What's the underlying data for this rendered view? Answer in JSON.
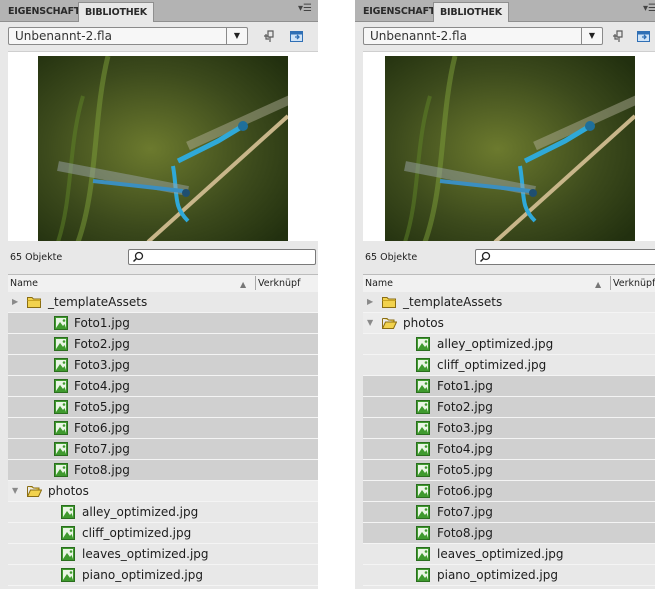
{
  "panels": [
    {
      "id": "left",
      "tabs": [
        "EIGENSCHAFTEN",
        "BIBLIOTHEK"
      ],
      "active_tab": "BIBLIOTHEK",
      "document": "Unbenannt-2.fla",
      "count": "65 Objekte",
      "columns": {
        "name": "Name",
        "linkage": "Verknüpf"
      },
      "rows": [
        {
          "label": "_templateAssets",
          "type": "folder-closed",
          "level": 0,
          "shade": "light"
        },
        {
          "label": "Foto1.jpg",
          "type": "bitmap",
          "level": 1,
          "shade": "dark"
        },
        {
          "label": "Foto2.jpg",
          "type": "bitmap",
          "level": 1,
          "shade": "dark"
        },
        {
          "label": "Foto3.jpg",
          "type": "bitmap",
          "level": 1,
          "shade": "dark"
        },
        {
          "label": "Foto4.jpg",
          "type": "bitmap",
          "level": 1,
          "shade": "dark"
        },
        {
          "label": "Foto5.jpg",
          "type": "bitmap",
          "level": 1,
          "shade": "dark"
        },
        {
          "label": "Foto6.jpg",
          "type": "bitmap",
          "level": 1,
          "shade": "dark"
        },
        {
          "label": "Foto7.jpg",
          "type": "bitmap",
          "level": 1,
          "shade": "dark"
        },
        {
          "label": "Foto8.jpg",
          "type": "bitmap",
          "level": 1,
          "shade": "dark"
        },
        {
          "label": "photos",
          "type": "folder-open",
          "level": 0,
          "shade": "plain"
        },
        {
          "label": "alley_optimized.jpg",
          "type": "bitmap",
          "level": 2,
          "shade": "light"
        },
        {
          "label": "cliff_optimized.jpg",
          "type": "bitmap",
          "level": 2,
          "shade": "light"
        },
        {
          "label": "leaves_optimized.jpg",
          "type": "bitmap",
          "level": 2,
          "shade": "light"
        },
        {
          "label": "piano_optimized.jpg",
          "type": "bitmap",
          "level": 2,
          "shade": "light"
        }
      ]
    },
    {
      "id": "right",
      "tabs": [
        "EIGENSCHAFTEN",
        "BIBLIOTHEK"
      ],
      "active_tab": "BIBLIOTHEK",
      "document": "Unbenannt-2.fla",
      "count": "65 Objekte",
      "columns": {
        "name": "Name",
        "linkage": "Verknüpf"
      },
      "rows": [
        {
          "label": "_templateAssets",
          "type": "folder-closed",
          "level": 0,
          "shade": "light"
        },
        {
          "label": "photos",
          "type": "folder-open",
          "level": 0,
          "shade": "plain"
        },
        {
          "label": "alley_optimized.jpg",
          "type": "bitmap",
          "level": 2,
          "shade": "light"
        },
        {
          "label": "cliff_optimized.jpg",
          "type": "bitmap",
          "level": 2,
          "shade": "light"
        },
        {
          "label": "Foto1.jpg",
          "type": "bitmap",
          "level": 2,
          "shade": "dark"
        },
        {
          "label": "Foto2.jpg",
          "type": "bitmap",
          "level": 2,
          "shade": "dark"
        },
        {
          "label": "Foto3.jpg",
          "type": "bitmap",
          "level": 2,
          "shade": "dark"
        },
        {
          "label": "Foto4.jpg",
          "type": "bitmap",
          "level": 2,
          "shade": "dark"
        },
        {
          "label": "Foto5.jpg",
          "type": "bitmap",
          "level": 2,
          "shade": "dark"
        },
        {
          "label": "Foto6.jpg",
          "type": "bitmap",
          "level": 2,
          "shade": "dark"
        },
        {
          "label": "Foto7.jpg",
          "type": "bitmap",
          "level": 2,
          "shade": "dark"
        },
        {
          "label": "Foto8.jpg",
          "type": "bitmap",
          "level": 2,
          "shade": "dark"
        },
        {
          "label": "leaves_optimized.jpg",
          "type": "bitmap",
          "level": 2,
          "shade": "light"
        },
        {
          "label": "piano_optimized.jpg",
          "type": "bitmap",
          "level": 2,
          "shade": "light"
        }
      ]
    }
  ],
  "icons": {
    "panel_menu": "panel-menu-icon",
    "new_symbol": "pin-icon",
    "new_library": "new-library-panel-icon",
    "search": "search-icon",
    "folder_closed": "folder-closed-icon",
    "folder_open": "folder-open-icon",
    "bitmap": "bitmap-icon",
    "sort": "sort-ascending-icon"
  },
  "colors": {
    "tabbar": "#b3b3b3",
    "panel": "#e8e8e8",
    "row_highlight": "#d0d0d0",
    "bitmap_green": "#3f9a2e",
    "folder_yellow": "#f2d24d"
  }
}
